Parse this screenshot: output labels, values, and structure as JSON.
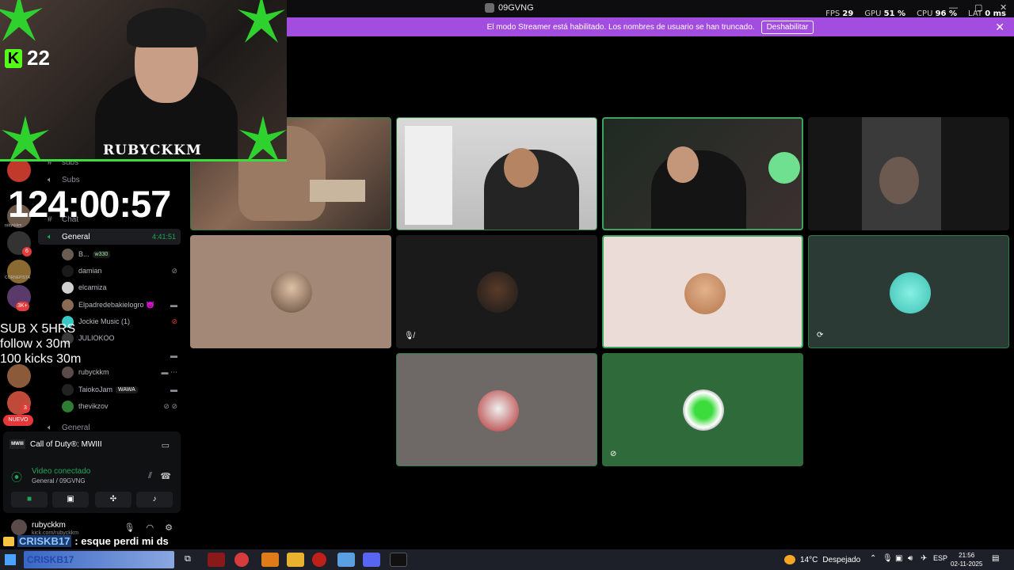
{
  "window": {
    "server_title": "09GVNG",
    "controls": [
      "—",
      "▢",
      "✕"
    ]
  },
  "perf": {
    "fps_label": "FPS",
    "fps": "29",
    "gpu_label": "GPU",
    "gpu": "51 %",
    "cpu_label": "CPU",
    "cpu": "96 %",
    "lat_label": "LAT",
    "lat": "0 ms"
  },
  "banner": {
    "text": "El modo Streamer está habilitado. Los nombres de usuario se han truncado.",
    "disable_label": "Deshabilitar",
    "close": "✕"
  },
  "overlay": {
    "kick_logo": "K",
    "kick_count": "22",
    "cam_name": "RUBYCKKM",
    "timer": "124:00:57",
    "goals": [
      "SUB X 5HRS",
      "follow x 30m",
      "100 kicks 30m"
    ]
  },
  "rail": {
    "badges": [
      "6",
      "3K+",
      "3"
    ],
    "server_labels": [
      "rubyckkm",
      "CORNEPISTA"
    ],
    "nuevo_label": "NUEVO"
  },
  "sidebar": {
    "channels_top": [
      "subs",
      "Subs",
      "Chat"
    ],
    "active_channel": "General",
    "active_time": "4:41:51",
    "voice_users": [
      {
        "name": "B...",
        "tag": "w330",
        "color": "#6a5c52"
      },
      {
        "name": "damian",
        "tag": "",
        "color": "#1a1a1a"
      },
      {
        "name": "elcamiza",
        "tag": "",
        "color": "#d0d0d0"
      },
      {
        "name": "Elpadredebakielogro 👿",
        "tag": "",
        "color": "#8a6b55"
      },
      {
        "name": "Jockie Music (1)",
        "tag": "",
        "color": "#36c9c6"
      },
      {
        "name": "JULIOKOO",
        "tag": "",
        "color": "#3a3a3a"
      },
      {
        "name": "",
        "tag": "",
        "color": "#000000"
      },
      {
        "name": "rubyckkm",
        "tag": "",
        "color": "#5a4a4a"
      },
      {
        "name": "TaiokoJam",
        "tag": "WAWA",
        "color": "#222222"
      },
      {
        "name": "thevikzov",
        "tag": "",
        "color": "#2e7d32"
      }
    ],
    "bottom_channel": "General"
  },
  "voice_panel": {
    "game": "Call of Duty®: MWIII",
    "game_icon": "MWIII",
    "status": "Video conectado",
    "sub": "General / 09GVNG"
  },
  "user_bar": {
    "username": "rubyckkm",
    "subtext": "kick.com/rubyckkm"
  },
  "chat": {
    "name": "CRISKB17",
    "message": ": esque perdi mi ds"
  },
  "taskbar": {
    "widget_text": "CRISKB17",
    "weather_temp": "14°C",
    "weather_desc": "Despejado",
    "lang": "ESP",
    "time": "21:56",
    "date": "02-11-2025"
  },
  "colors": {
    "accent_green": "#3ba55d",
    "banner_purple": "#a34de0",
    "kick_green": "#53fc18"
  }
}
